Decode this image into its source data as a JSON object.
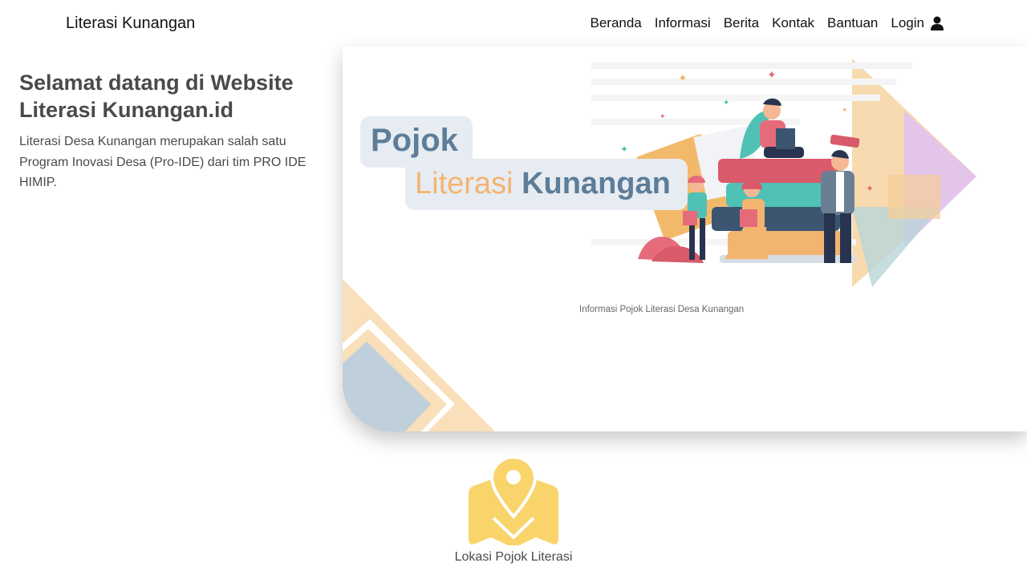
{
  "navbar": {
    "brand": "Literasi Kunangan",
    "links": [
      "Beranda",
      "Informasi",
      "Berita",
      "Kontak",
      "Bantuan"
    ],
    "login": "Login",
    "login_icon": "user-icon"
  },
  "hero": {
    "title": "Selamat datang di Website Literasi Kunangan.id",
    "description": "Literasi Desa Kunangan merupakan salah satu Program Inovasi Desa (Pro-IDE) dari tim PRO IDE HIMIP."
  },
  "banner": {
    "word1": "Pojok",
    "word2_light": "Literasi",
    "word2_bold": "Kunangan",
    "caption": "Informasi Pojok Literasi Desa Kunangan"
  },
  "location": {
    "label": "Lokasi Pojok Literasi",
    "icon": "map-pin-icon",
    "icon_color": "#f9d46b"
  },
  "colors": {
    "banner_blue": "#5d7d99",
    "banner_orange": "#f3b46f",
    "text_gray": "#4a4a4a"
  }
}
